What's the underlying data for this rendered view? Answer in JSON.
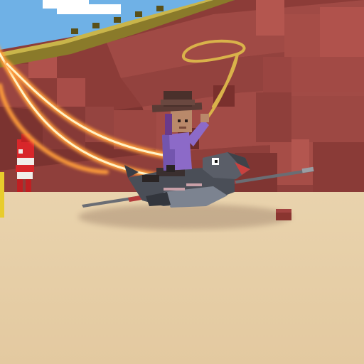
{
  "scene": {
    "colors": {
      "sky": "#6fb1e6",
      "cloud": "#ffffff",
      "wall_dark": "#7a2f2c",
      "wall_mid": "#9a4541",
      "wall_light": "#b0524c",
      "wall_shadow": "#5d2422",
      "ground": "#e6cfa8",
      "ground_far": "#e9d3ad",
      "ground_shadow": "#c2a98a",
      "trim": "#8a7a2a",
      "trim_light": "#c9b54a",
      "lasso": "#d9b24a",
      "streak_outer": "#ff9c3a",
      "streak_inner": "#fff3c8",
      "creature_body": "#4a4e57",
      "creature_belly": "#7c8390",
      "spear": "#6a6d74",
      "spear_tip": "#b33a3a",
      "shirt": "#8c6ac8",
      "skin": "#b9896a",
      "hat": "#5a3b35",
      "hair": "#6a3a8a",
      "yellow_block": "#e8cc2c",
      "crate": "#8a3530",
      "npc_red": "#d8262a",
      "npc_white": "#f0eeea"
    }
  }
}
